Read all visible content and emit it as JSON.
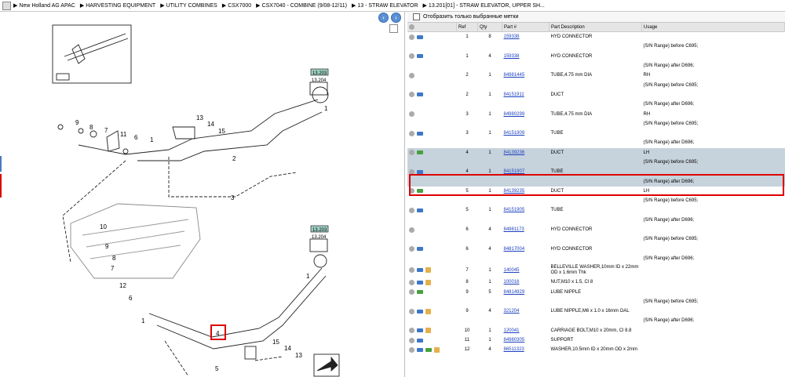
{
  "breadcrumb": [
    "New Holland AG APAC",
    "HARVESTING EQUIPMENT",
    "UTILITY COMBINES",
    "CSX7000",
    "CSX7040 - COMBINE (9/08-12/11)",
    "13 - STRAW ELEVATOR",
    "13.201[01] - STRAW ELEVATOR, UPPER SH..."
  ],
  "filter_label": "Отобразить только выбранные метки",
  "columns": [
    "Ref",
    "Qty",
    "Part #",
    "Part Description",
    "Usage"
  ],
  "rows": [
    {
      "icons": [
        "gray",
        "blue"
      ],
      "ref": "1",
      "qty": "8",
      "pn": "159338",
      "desc": "HYD CONNECTOR",
      "usage": ""
    },
    {
      "icons": [],
      "ref": "",
      "qty": "",
      "pn": "",
      "desc": "",
      "usage": "(S/N Range) before C695;"
    },
    {
      "icons": [
        "gray",
        "blue"
      ],
      "ref": "1",
      "qty": "4",
      "pn": "159338",
      "desc": "HYD CONNECTOR",
      "usage": ""
    },
    {
      "icons": [],
      "ref": "",
      "qty": "",
      "pn": "",
      "desc": "",
      "usage": "(S/N Range) after D696;"
    },
    {
      "icons": [
        "gray"
      ],
      "ref": "2",
      "qty": "1",
      "pn": "84981445",
      "desc": "TUBE,4.75 mm DIA",
      "usage": "RH"
    },
    {
      "icons": [],
      "ref": "",
      "qty": "",
      "pn": "",
      "desc": "",
      "usage": "(S/N Range) before C695;"
    },
    {
      "icons": [
        "gray",
        "blue"
      ],
      "ref": "2",
      "qty": "1",
      "pn": "84151911",
      "desc": "DUCT",
      "usage": ""
    },
    {
      "icons": [],
      "ref": "",
      "qty": "",
      "pn": "",
      "desc": "",
      "usage": "(S/N Range) after D696;"
    },
    {
      "icons": [
        "gray"
      ],
      "ref": "3",
      "qty": "1",
      "pn": "84980299",
      "desc": "TUBE,4.75 mm DIA",
      "usage": "RH"
    },
    {
      "icons": [],
      "ref": "",
      "qty": "",
      "pn": "",
      "desc": "",
      "usage": "(S/N Range) before C695;"
    },
    {
      "icons": [
        "gray",
        "blue"
      ],
      "ref": "3",
      "qty": "1",
      "pn": "84151909",
      "desc": "TUBE",
      "usage": ""
    },
    {
      "icons": [],
      "ref": "",
      "qty": "",
      "pn": "",
      "desc": "",
      "usage": "(S/N Range) after D696;"
    },
    {
      "icons": [
        "gray",
        "green"
      ],
      "ref": "4",
      "qty": "1",
      "pn": "84139236",
      "desc": "DUCT",
      "usage": "LH",
      "sel": true
    },
    {
      "icons": [],
      "ref": "",
      "qty": "",
      "pn": "",
      "desc": "",
      "usage": "(S/N Range) before C695;",
      "sel": true
    },
    {
      "icons": [
        "gray",
        "blue"
      ],
      "ref": "4",
      "qty": "1",
      "pn": "84151907",
      "desc": "TUBE",
      "usage": "",
      "sel": true
    },
    {
      "icons": [],
      "ref": "",
      "qty": "",
      "pn": "",
      "desc": "",
      "usage": "(S/N Range) after D696;",
      "sel": true
    },
    {
      "icons": [
        "gray",
        "green"
      ],
      "ref": "5",
      "qty": "1",
      "pn": "84139235",
      "desc": "DUCT",
      "usage": "LH"
    },
    {
      "icons": [],
      "ref": "",
      "qty": "",
      "pn": "",
      "desc": "",
      "usage": "(S/N Range) before C695;"
    },
    {
      "icons": [
        "gray",
        "blue"
      ],
      "ref": "5",
      "qty": "1",
      "pn": "84151905",
      "desc": "TUBE",
      "usage": ""
    },
    {
      "icons": [],
      "ref": "",
      "qty": "",
      "pn": "",
      "desc": "",
      "usage": "(S/N Range) after D696;"
    },
    {
      "icons": [
        "gray"
      ],
      "ref": "6",
      "qty": "4",
      "pn": "84981173",
      "desc": "HYD CONNECTOR",
      "usage": ""
    },
    {
      "icons": [],
      "ref": "",
      "qty": "",
      "pn": "",
      "desc": "",
      "usage": "(S/N Range) before C695;"
    },
    {
      "icons": [
        "gray",
        "blue"
      ],
      "ref": "6",
      "qty": "4",
      "pn": "84817004",
      "desc": "HYD CONNECTOR",
      "usage": ""
    },
    {
      "icons": [],
      "ref": "",
      "qty": "",
      "pn": "",
      "desc": "",
      "usage": "(S/N Range) after D696;"
    },
    {
      "icons": [
        "gray",
        "blue",
        "box"
      ],
      "ref": "7",
      "qty": "1",
      "pn": "140045",
      "desc": "BELLEVILLE WASHER,10mm ID x 22mm OD x 1.6mm Thk",
      "usage": "",
      "tall": true
    },
    {
      "icons": [
        "gray",
        "blue",
        "box"
      ],
      "ref": "8",
      "qty": "1",
      "pn": "100016",
      "desc": "NUT,M10 x 1.5, Cl 8",
      "usage": ""
    },
    {
      "icons": [
        "gray",
        "green"
      ],
      "ref": "9",
      "qty": "5",
      "pn": "84814929",
      "desc": "LUBE NIPPLE",
      "usage": ""
    },
    {
      "icons": [],
      "ref": "",
      "qty": "",
      "pn": "",
      "desc": "",
      "usage": "(S/N Range) before C695;"
    },
    {
      "icons": [
        "gray",
        "blue",
        "box"
      ],
      "ref": "9",
      "qty": "4",
      "pn": "321204",
      "desc": "LUBE NIPPLE,M6 x 1.0 x 16mm OAL",
      "usage": ""
    },
    {
      "icons": [],
      "ref": "",
      "qty": "",
      "pn": "",
      "desc": "",
      "usage": "(S/N Range) after D696;"
    },
    {
      "icons": [
        "gray",
        "blue",
        "box"
      ],
      "ref": "10",
      "qty": "1",
      "pn": "120041",
      "desc": "CARRIAGE BOLT,M10 x 20mm, Cl 8.8",
      "usage": ""
    },
    {
      "icons": [
        "gray",
        "blue"
      ],
      "ref": "11",
      "qty": "1",
      "pn": "84980305",
      "desc": "SUPPORT",
      "usage": ""
    },
    {
      "icons": [
        "gray",
        "blue",
        "green",
        "box"
      ],
      "ref": "12",
      "qty": "4",
      "pn": "86511323",
      "desc": "WASHER,10.5mm ID x 20mm OD x 2mm",
      "usage": ""
    }
  ],
  "diagram": {
    "callouts": [
      "9",
      "8",
      "7",
      "11",
      "6",
      "1",
      "13",
      "14",
      "15",
      "2",
      "3",
      "1",
      "10",
      "9",
      "8",
      "7",
      "12",
      "6",
      "1",
      "4",
      "15",
      "14",
      "13",
      "5",
      "1"
    ],
    "ref_tag_top": "13.203",
    "ref_tag_bottom": "13.204",
    "ref_tag_top2": "13.203",
    "ref_tag_bottom2": "13.204"
  }
}
